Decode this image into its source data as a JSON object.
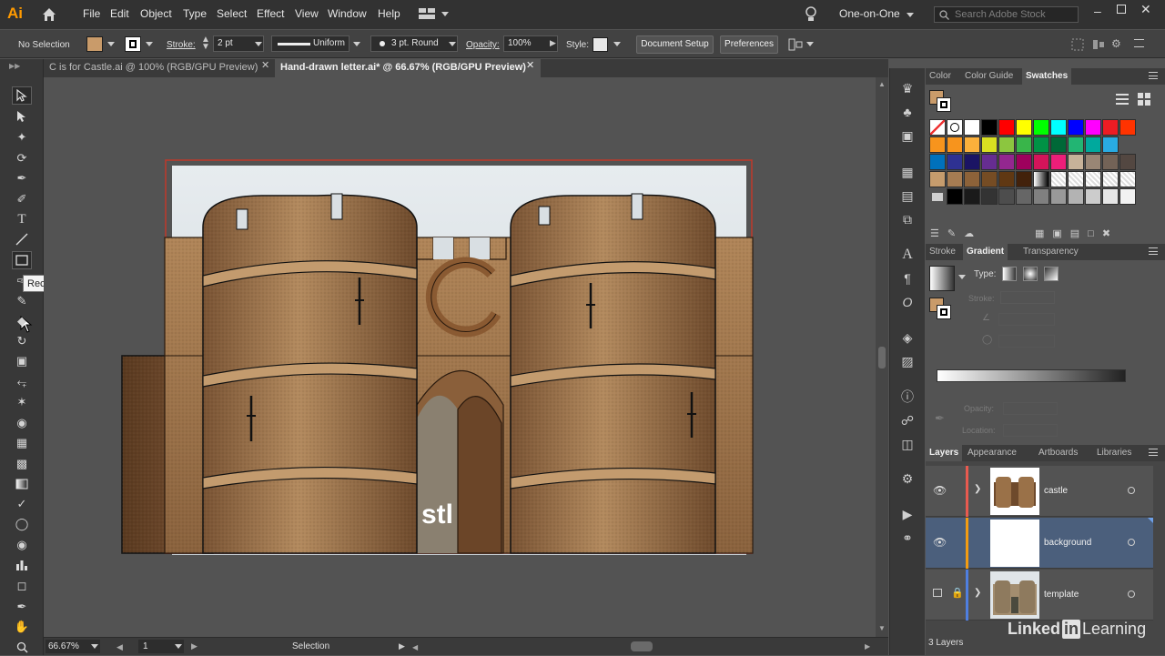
{
  "app": {
    "logo": "Ai",
    "menus": [
      "File",
      "Edit",
      "Object",
      "Type",
      "Select",
      "Effect",
      "View",
      "Window",
      "Help"
    ],
    "workspace": "One-on-One",
    "search_placeholder": "Search Adobe Stock"
  },
  "control_bar": {
    "selection_label": "No Selection",
    "fill_color": "#c99b6a",
    "stroke_label": "Stroke:",
    "stroke_weight": "2 pt",
    "stroke_profile": "Uniform",
    "brush": "3 pt. Round",
    "opacity_label": "Opacity:",
    "opacity_value": "100%",
    "style_label": "Style:",
    "document_setup": "Document Setup",
    "preferences": "Preferences"
  },
  "tabs": [
    {
      "label": "C is for Castle.ai @ 100% (RGB/GPU Preview)",
      "active": false
    },
    {
      "label": "Hand-drawn letter.ai* @ 66.67% (RGB/GPU Preview)",
      "active": true
    }
  ],
  "tooltip": "Rectangle Tool (M)",
  "tools": [
    "selection-tool",
    "direct-selection-tool",
    "magic-wand-tool",
    "lasso-tool",
    "pen-tool",
    "curvature-tool",
    "type-tool",
    "line-segment-tool",
    "rectangle-tool",
    "paintbrush-tool",
    "shaper-tool",
    "eraser-tool",
    "rotate-tool",
    "scale-tool",
    "width-tool",
    "puppet-warp-tool",
    "shape-builder-tool",
    "perspective-grid-tool",
    "mesh-tool",
    "gradient-tool",
    "eyedropper-tool",
    "blend-tool",
    "symbol-sprayer-tool",
    "column-graph-tool",
    "artboard-tool",
    "slice-tool",
    "hand-tool",
    "zoom-tool"
  ],
  "canvas": {
    "artwork_letter": "C",
    "artwork_partial_text": "stl"
  },
  "status_bar": {
    "zoom": "66.67%",
    "artboard": "1",
    "mode": "Selection"
  },
  "swatches_panel": {
    "tabs": [
      "Color",
      "Color Guide",
      "Swatches"
    ],
    "active_tab": "Swatches",
    "rows": [
      [
        "none",
        "registration",
        "#ffffff",
        "#000000",
        "#ff0000",
        "#ffff00",
        "#00ff00",
        "#00ffff",
        "#0000ff",
        "#ff00ff",
        "#ed1c24",
        "#ff3300"
      ],
      [
        "#f7941d",
        "#f7941d",
        "#fbb03b",
        "#d9e021",
        "#8cc63f",
        "#39b54a",
        "#009245",
        "#006837",
        "#22b573",
        "#00a99d",
        "#29abe2"
      ],
      [
        "#0071bc",
        "#2e3192",
        "#1b1464",
        "#662d91",
        "#93278f",
        "#9e005d",
        "#d4145a",
        "#ed1e79",
        "#c7b299",
        "#998675",
        "#736357",
        "#534741"
      ],
      [
        "#c69c6d",
        "#a67c52",
        "#8c6239",
        "#754c24",
        "#603813",
        "#42210b",
        "gradient",
        "pattern",
        "pattern",
        "pattern",
        "pattern",
        "pattern"
      ],
      [
        "folder",
        "#000000",
        "#1a1a1a",
        "#333333",
        "#4d4d4d",
        "#666666",
        "#808080",
        "#999999",
        "#b3b3b3",
        "#cccccc",
        "#e6e6e6",
        "#f2f2f2"
      ]
    ]
  },
  "gradient_panel": {
    "tabs": [
      "Stroke",
      "Gradient",
      "Transparency"
    ],
    "active_tab": "Gradient",
    "type_label": "Type:",
    "stroke_label": "Stroke:",
    "opacity_label": "Opacity:",
    "location_label": "Location:"
  },
  "layers_panel": {
    "tabs": [
      "Layers",
      "Appearance",
      "Artboards",
      "Libraries"
    ],
    "active_tab": "Layers",
    "layers": [
      {
        "name": "castle",
        "color": "#e85a4f",
        "selected": false
      },
      {
        "name": "background",
        "color": "#f39c12",
        "selected": true
      },
      {
        "name": "template",
        "color": "#4f7fe0",
        "selected": false
      }
    ],
    "count": "3 Layers"
  },
  "watermark": "Linked in Learning"
}
